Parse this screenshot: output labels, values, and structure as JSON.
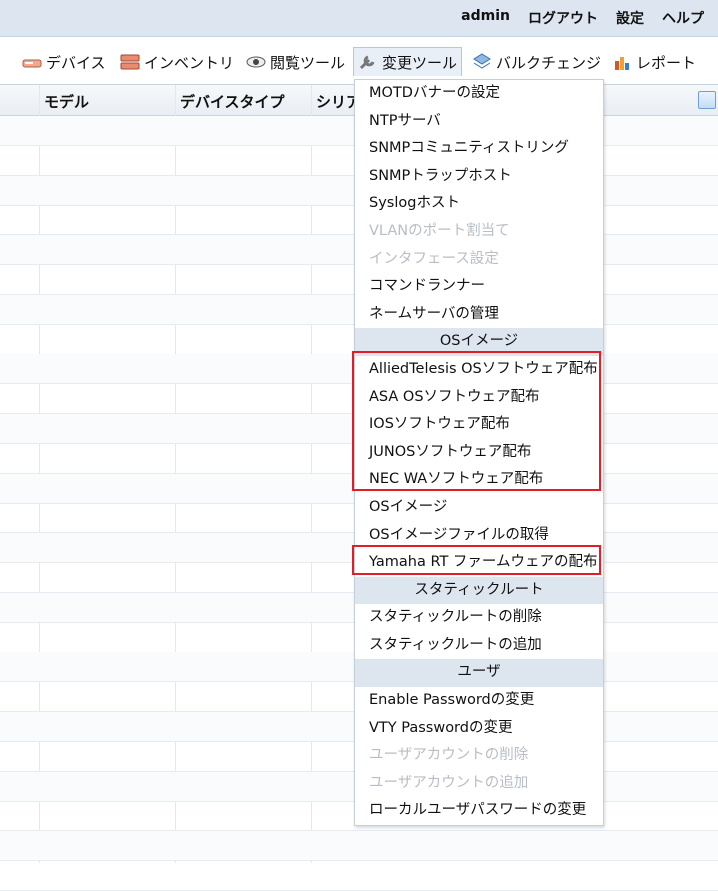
{
  "header": {
    "user": "admin",
    "logout": "ログアウト",
    "settings": "設定",
    "help": "ヘルプ"
  },
  "toolbar": {
    "devices": "デバイス",
    "inventory": "インベントリ",
    "view_tools": "閲覧ツール",
    "change_tools": "変更ツール",
    "bulk_change": "バルクチェンジ",
    "reports": "レポート"
  },
  "grid": {
    "columns": [
      "モデル",
      "デバイスタイプ",
      "シリア"
    ]
  },
  "menu": {
    "item1": "MOTDバナーの設定",
    "item2": "NTPサーバ",
    "item3": "SNMPコミュニティストリング",
    "item4": "SNMPトラップホスト",
    "item5": "Syslogホスト",
    "item6": "VLANのポート割当て",
    "item7": "インタフェース設定",
    "item8": "コマンドランナー",
    "item9": "ネームサーバの管理",
    "header_os": "OSイメージ",
    "os1": "AlliedTelesis OSソフトウェア配布",
    "os2": "ASA OSソフトウェア配布",
    "os3": "IOSソフトウェア配布",
    "os4": "JUNOSソフトウェア配布",
    "os5": "NEC WAソフトウェア配布",
    "os6": "OSイメージ",
    "os7": "OSイメージファイルの取得",
    "os8": "Yamaha RT ファームウェアの配布",
    "header_static": "スタティックルート",
    "st1": "スタティックルートの削除",
    "st2": "スタティックルートの追加",
    "header_user": "ユーザ",
    "u1": "Enable Passwordの変更",
    "u2": "VTY Passwordの変更",
    "u3": "ユーザアカウントの削除",
    "u4": "ユーザアカウントの追加",
    "u5": "ローカルユーザパスワードの変更"
  },
  "colors": {
    "highlight_box": "#e11d2a",
    "menu_header_bg": "#dde5ef",
    "disabled_text": "#b8bec6"
  }
}
